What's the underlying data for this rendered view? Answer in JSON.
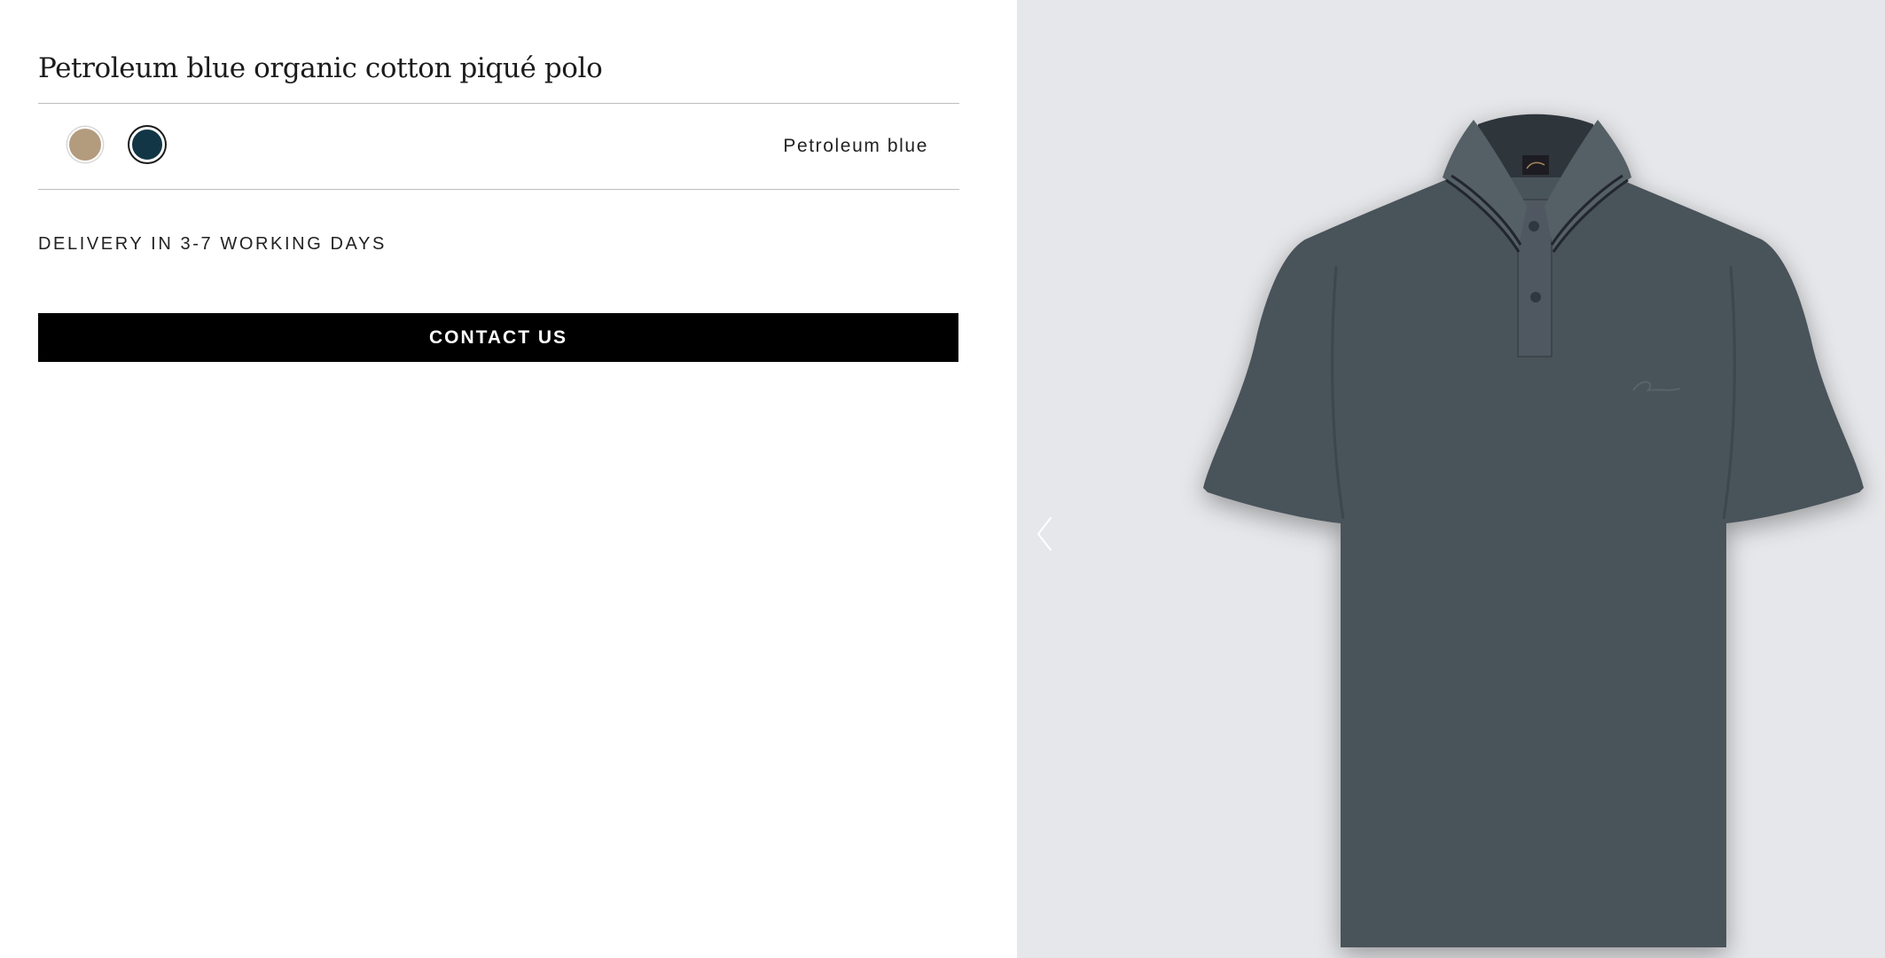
{
  "product": {
    "title": "Petroleum blue organic cotton piqué polo",
    "selected_color": "Petroleum blue",
    "delivery": "DELIVERY IN 3-7 WORKING DAYS",
    "contact_label": "CONTACT US"
  },
  "swatches": [
    {
      "color": "#b39b7e"
    },
    {
      "color": "#123646"
    }
  ],
  "gallery": {
    "background": "#e6e7ea",
    "prev_icon": "chevron-left-icon"
  },
  "colors": {
    "button_bg": "#000000",
    "garment": "#48525a",
    "collar": "#555e66"
  }
}
